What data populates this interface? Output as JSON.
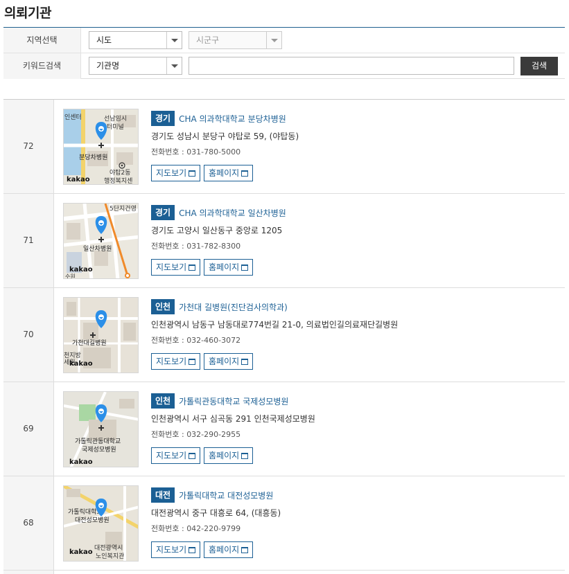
{
  "page_title": "의뢰기관",
  "search": {
    "region_label": "지역선택",
    "sido_value": "시도",
    "sigungu_placeholder": "시군구",
    "keyword_label": "키워드검색",
    "keyword_type_value": "기관명",
    "keyword_value": "",
    "search_button": "검색"
  },
  "map_brand": "kakao",
  "buttons": {
    "map_view": "지도보기",
    "homepage": "홈페이지"
  },
  "phone_prefix": "전화번호 : ",
  "rows": [
    {
      "num": "72",
      "region": "경기",
      "name": "CHA 의과학대학교 분당차병원",
      "address": "경기도 성남시 분당구 야탑로 59, (야탑동)",
      "phone": "031-780-5000",
      "map_labels": [
        "선남임시",
        "터미널",
        "분당차병원",
        "야탑2동",
        "행정복지센",
        "인센터"
      ]
    },
    {
      "num": "71",
      "region": "경기",
      "name": "CHA 의과학대학교 일산차병원",
      "address": "경기도 고양시 일산동구 중앙로 1205",
      "phone": "031-782-8300",
      "map_labels": [
        "5단지건영",
        "일산차병원",
        "수원"
      ]
    },
    {
      "num": "70",
      "region": "인천",
      "name": "가천대 길병원(진단검사의학과)",
      "address": "인천광역시 남동구 남동대로774번길 21-0, 의료법인길의료재단길병원",
      "phone": "032-460-3072",
      "map_labels": [
        "가천대길병원",
        "천지방",
        "세원"
      ]
    },
    {
      "num": "69",
      "region": "인천",
      "name": "가톨릭관동대학교 국제성모병원",
      "address": "인천광역시 서구 심곡동 291 인천국제성모병원",
      "phone": "032-290-2955",
      "map_labels": [
        "가톨릭관동대학교",
        "국제성모병원"
      ]
    },
    {
      "num": "68",
      "region": "대전",
      "name": "가톨릭대학교 대전성모병원",
      "address": "대전광역시 중구 대흥로 64, (대흥동)",
      "phone": "042-220-9799",
      "map_labels": [
        "가톨릭대학교",
        "대전성모병원",
        "대전광역시",
        "노인복지관"
      ]
    }
  ],
  "colors": {
    "accent": "#1b5f94",
    "pin": "#2b8fe8",
    "dark_button": "#3a3a3a"
  }
}
